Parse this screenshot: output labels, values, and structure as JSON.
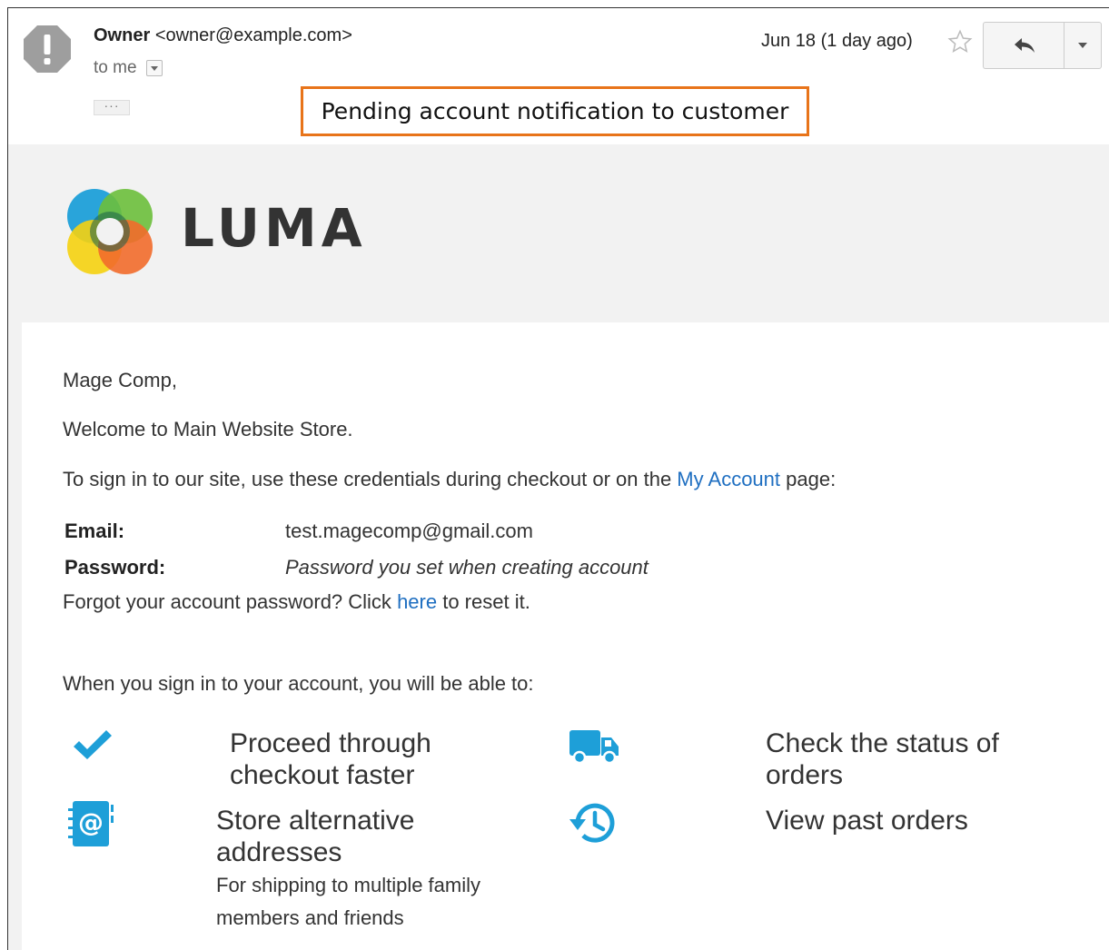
{
  "header": {
    "sender_name": "Owner",
    "sender_email": "<owner@example.com>",
    "to_label": "to me",
    "date": "Jun 18 (1 day ago)",
    "ellipsis": "···"
  },
  "annotation": "Pending account notification to customer",
  "logo": {
    "text": "LUMA"
  },
  "body": {
    "greeting": "Mage Comp,",
    "welcome": "Welcome to Main Website Store.",
    "signin_prefix": "To sign in to our site, use these credentials during checkout or on the ",
    "signin_link": "My Account",
    "signin_suffix": " page:",
    "email_label": "Email:",
    "email_value": "test.magecomp@gmail.com",
    "password_label": "Password:",
    "password_value": "Password you set when creating account",
    "forgot_prefix": "Forgot your account password? Click ",
    "forgot_link": "here",
    "forgot_suffix": " to reset it.",
    "able_to": "When you sign in to your account, you will be able to:"
  },
  "features": [
    {
      "title_line1": "Proceed through",
      "title_line2": "checkout faster",
      "icon": "checkmark-icon"
    },
    {
      "title_line1": "Check the status of",
      "title_line2": "orders",
      "icon": "truck-icon"
    },
    {
      "title_line1": "Store alternative",
      "title_line2": "addresses",
      "sub_line1": "For shipping to multiple family",
      "sub_line2": "members and friends",
      "icon": "address-book-icon"
    },
    {
      "title_line1": "View past orders",
      "icon": "history-icon"
    }
  ],
  "colors": {
    "link": "#1f6fc1",
    "icon_blue": "#1e9fd8",
    "annotation_border": "#e8741a"
  }
}
